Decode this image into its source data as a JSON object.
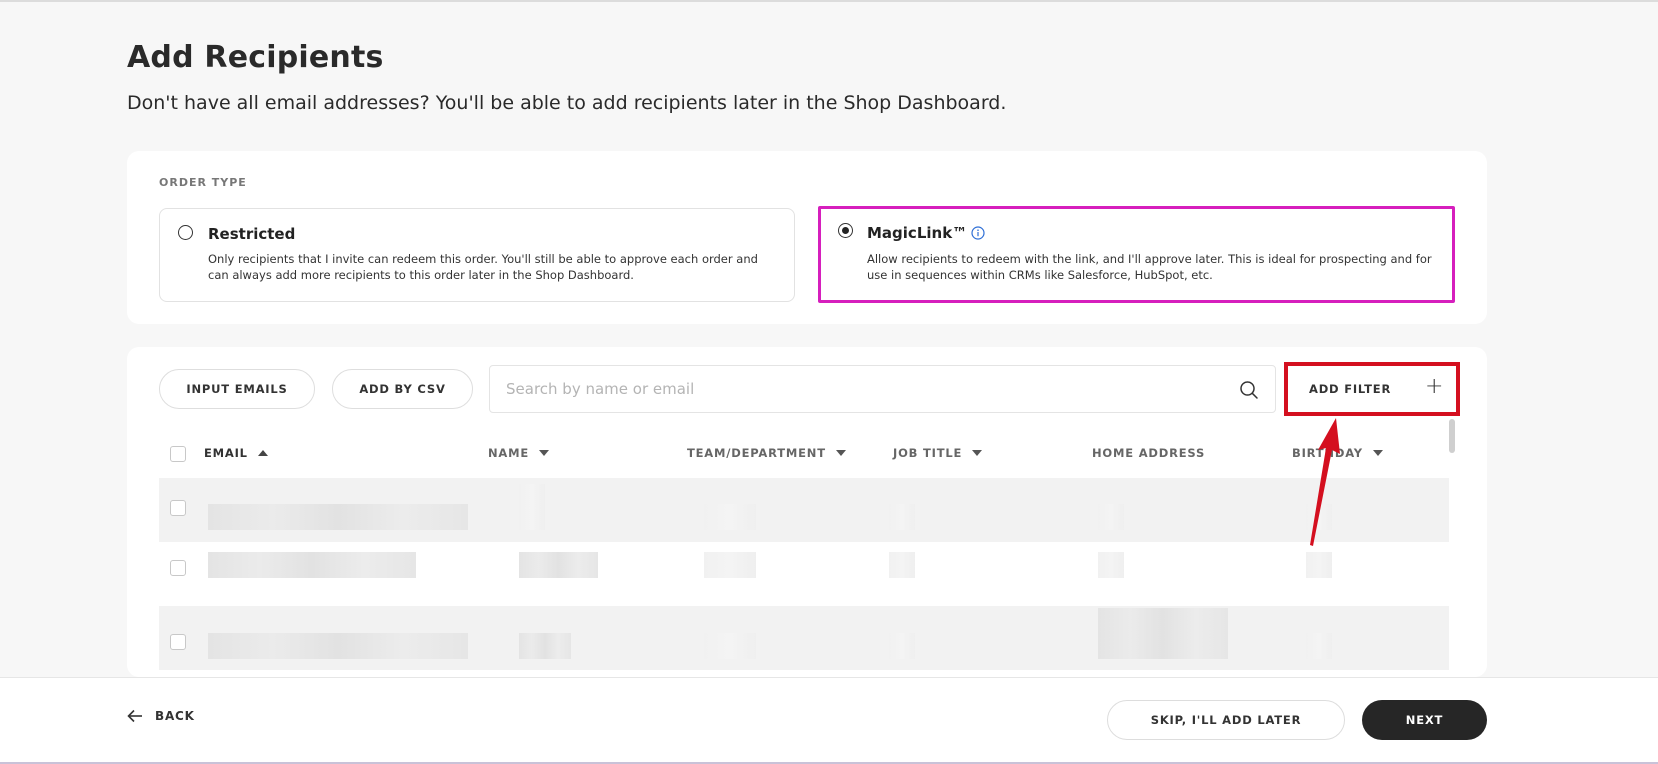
{
  "header": {
    "title": "Add Recipients",
    "subtitle": "Don't have all email addresses? You'll be able to add recipients later in the Shop Dashboard."
  },
  "order_type": {
    "label": "ORDER TYPE",
    "options": [
      {
        "title": "Restricted",
        "description": "Only recipients that I invite can redeem this order. You'll still be able to approve each order and can always add more recipients to this order later in the Shop Dashboard.",
        "selected": false
      },
      {
        "title": "MagicLink™",
        "description": "Allow recipients to redeem with the link, and I'll approve later. This is ideal for prospecting and for use in sequences within CRMs like Salesforce, HubSpot, etc.",
        "selected": true
      }
    ]
  },
  "toolbar": {
    "input_emails_label": "INPUT EMAILS",
    "add_csv_label": "ADD BY CSV",
    "search_placeholder": "Search by name or email",
    "search_value": "",
    "add_filter_label": "ADD FILTER"
  },
  "table": {
    "columns": [
      "EMAIL",
      "NAME",
      "TEAM/DEPARTMENT",
      "JOB TITLE",
      "HOME ADDRESS",
      "BIRTHDAY"
    ],
    "sort_column": "EMAIL",
    "sort_direction": "asc"
  },
  "footer": {
    "back_label": "BACK",
    "skip_label": "SKIP, I'LL ADD LATER",
    "next_label": "NEXT"
  },
  "colors": {
    "highlight_magenta": "#d61fbd",
    "annotation_red": "#d40f1f",
    "info_blue": "#2f6fd6",
    "next_button_bg": "#262626"
  }
}
